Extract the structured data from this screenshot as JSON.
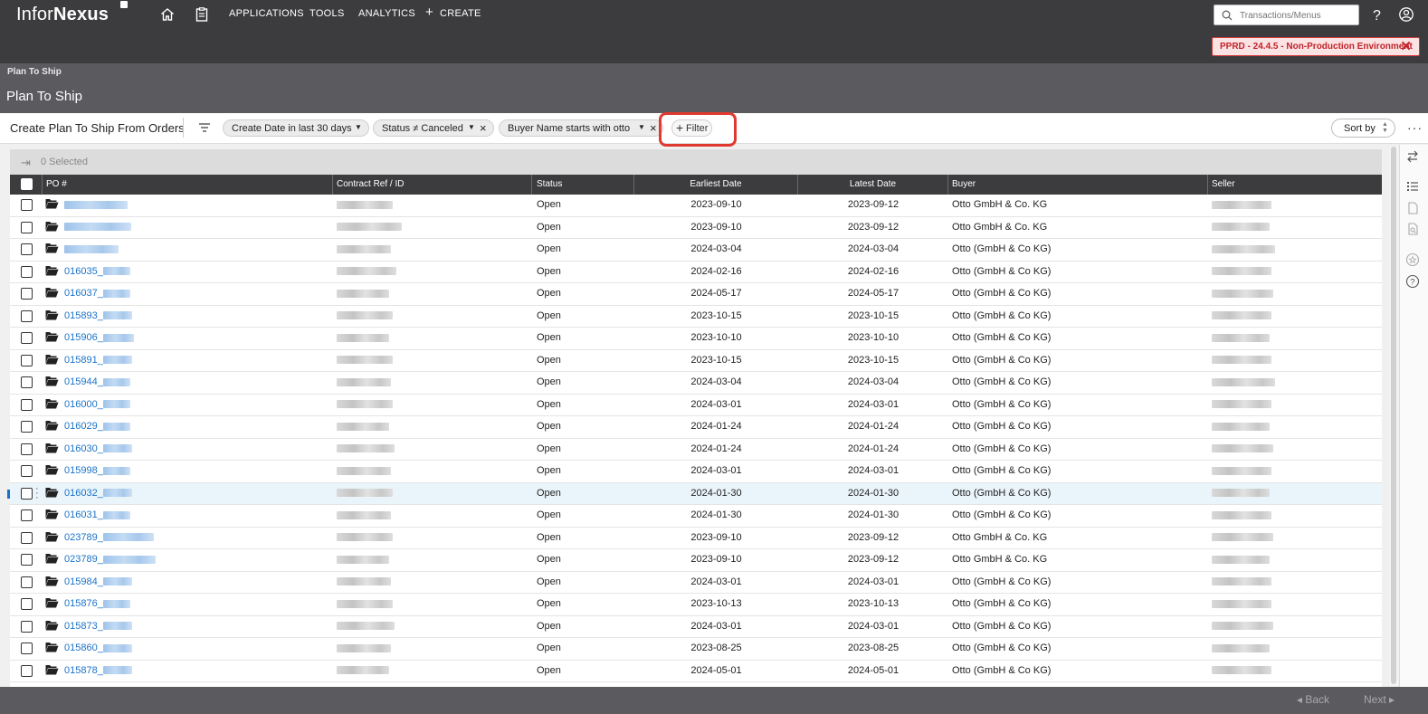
{
  "app": {
    "logo_light": "Infor",
    "logo_bold": "Nexus",
    "nav": [
      "APPLICATIONS",
      "TOOLS",
      "ANALYTICS"
    ],
    "create_label": "CREATE",
    "search_placeholder": "Transactions/Menus",
    "env_banner": "PPRD - 24.4.5 - Non-Production Environment"
  },
  "page": {
    "breadcrumb": "Plan To Ship",
    "title": "Plan To Ship"
  },
  "toolbar": {
    "title": "Create Plan To Ship From Orders",
    "chips": [
      "Create Date in last 30 days",
      "Status ≠ Canceled",
      "Buyer Name starts with otto"
    ],
    "add_filter": "Filter",
    "sort_label": "Sort by",
    "more": "···"
  },
  "grid": {
    "selected_text": "0 Selected",
    "columns": [
      "PO #",
      "Contract Ref / ID",
      "Status",
      "Earliest Date",
      "Latest Date",
      "Buyer",
      "Seller"
    ],
    "rows": [
      {
        "po": "",
        "status": "Open",
        "earliest": "2023-09-10",
        "latest": "2023-09-12",
        "buyer": "Otto GmbH & Co. KG"
      },
      {
        "po": "",
        "status": "Open",
        "earliest": "2023-09-10",
        "latest": "2023-09-12",
        "buyer": "Otto GmbH & Co. KG"
      },
      {
        "po": "",
        "status": "Open",
        "earliest": "2024-03-04",
        "latest": "2024-03-04",
        "buyer": "Otto (GmbH & Co KG)"
      },
      {
        "po": "016035_",
        "status": "Open",
        "earliest": "2024-02-16",
        "latest": "2024-02-16",
        "buyer": "Otto (GmbH & Co KG)"
      },
      {
        "po": "016037_",
        "status": "Open",
        "earliest": "2024-05-17",
        "latest": "2024-05-17",
        "buyer": "Otto (GmbH & Co KG)"
      },
      {
        "po": "015893_",
        "status": "Open",
        "earliest": "2023-10-15",
        "latest": "2023-10-15",
        "buyer": "Otto (GmbH & Co KG)"
      },
      {
        "po": "015906_",
        "status": "Open",
        "earliest": "2023-10-10",
        "latest": "2023-10-10",
        "buyer": "Otto (GmbH & Co KG)"
      },
      {
        "po": "015891_",
        "status": "Open",
        "earliest": "2023-10-15",
        "latest": "2023-10-15",
        "buyer": "Otto (GmbH & Co KG)"
      },
      {
        "po": "015944_",
        "status": "Open",
        "earliest": "2024-03-04",
        "latest": "2024-03-04",
        "buyer": "Otto (GmbH & Co KG)"
      },
      {
        "po": "016000_",
        "status": "Open",
        "earliest": "2024-03-01",
        "latest": "2024-03-01",
        "buyer": "Otto (GmbH & Co KG)"
      },
      {
        "po": "016029_",
        "status": "Open",
        "earliest": "2024-01-24",
        "latest": "2024-01-24",
        "buyer": "Otto (GmbH & Co KG)"
      },
      {
        "po": "016030_",
        "status": "Open",
        "earliest": "2024-01-24",
        "latest": "2024-01-24",
        "buyer": "Otto (GmbH & Co KG)"
      },
      {
        "po": "015998_",
        "status": "Open",
        "earliest": "2024-03-01",
        "latest": "2024-03-01",
        "buyer": "Otto (GmbH & Co KG)"
      },
      {
        "po": "016032_",
        "status": "Open",
        "earliest": "2024-01-30",
        "latest": "2024-01-30",
        "buyer": "Otto (GmbH & Co KG)",
        "active": true
      },
      {
        "po": "016031_",
        "status": "Open",
        "earliest": "2024-01-30",
        "latest": "2024-01-30",
        "buyer": "Otto (GmbH & Co KG)"
      },
      {
        "po": "023789_",
        "status": "Open",
        "earliest": "2023-09-10",
        "latest": "2023-09-12",
        "buyer": "Otto GmbH & Co. KG"
      },
      {
        "po": "023789_",
        "status": "Open",
        "earliest": "2023-09-10",
        "latest": "2023-09-12",
        "buyer": "Otto GmbH & Co. KG"
      },
      {
        "po": "015984_",
        "status": "Open",
        "earliest": "2024-03-01",
        "latest": "2024-03-01",
        "buyer": "Otto (GmbH & Co KG)"
      },
      {
        "po": "015876_",
        "status": "Open",
        "earliest": "2023-10-13",
        "latest": "2023-10-13",
        "buyer": "Otto (GmbH & Co KG)"
      },
      {
        "po": "015873_",
        "status": "Open",
        "earliest": "2024-03-01",
        "latest": "2024-03-01",
        "buyer": "Otto (GmbH & Co KG)"
      },
      {
        "po": "015860_",
        "status": "Open",
        "earliest": "2023-08-25",
        "latest": "2023-08-25",
        "buyer": "Otto (GmbH & Co KG)"
      },
      {
        "po": "015878_",
        "status": "Open",
        "earliest": "2024-05-01",
        "latest": "2024-05-01",
        "buyer": "Otto (GmbH & Co KG)"
      }
    ]
  },
  "footer": {
    "back": "Back",
    "next": "Next"
  },
  "colors": {
    "topbar": "#3c3c3e",
    "header": "#5a5a5f",
    "link": "#1a73c8",
    "highlight": "#e0392f"
  }
}
